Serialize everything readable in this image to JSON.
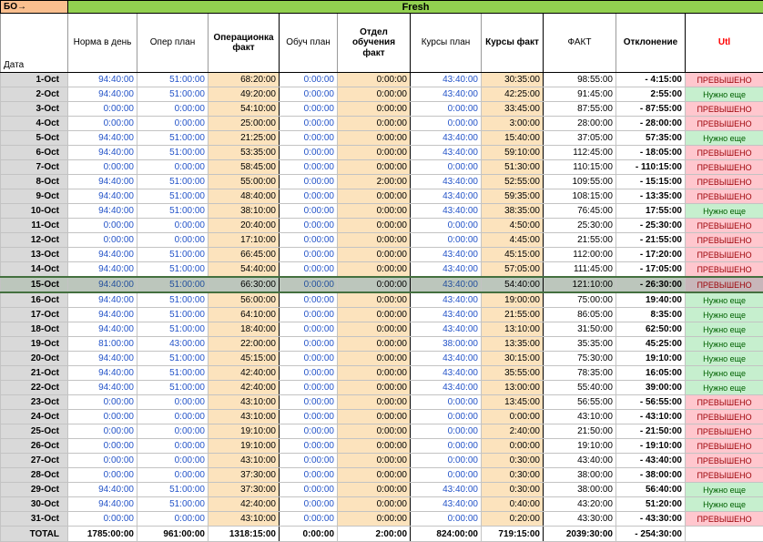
{
  "sheet": {
    "corner_label": "БО→",
    "banner": "Fresh"
  },
  "columns": [
    "Дата",
    "Норма в день",
    "Опер план",
    "Операционка факт",
    "Обуч план",
    "Отдел обучения факт",
    "Курсы план",
    "Курсы факт",
    "ФАКТ",
    "Отклонение",
    "Utl"
  ],
  "colors": {
    "banner_green": "#92D050",
    "corner_orange": "#FABF8F",
    "fact_cell_bg": "#FCE3BD",
    "plan_text_blue": "#2353C8",
    "date_col_grey": "#D9D9D9",
    "utl_over_bg": "#FFC7CE",
    "utl_over_text": "#9C0006",
    "utl_need_bg": "#C6EFCE",
    "utl_need_text": "#006100",
    "utl_header_text": "#FF0000",
    "highlight_row_bg": "#BCC6BC"
  },
  "rows": [
    {
      "date": "1-Oct",
      "norm": "94:40:00",
      "oper_plan": "51:00:00",
      "oper_fact": "68:20:00",
      "edu_plan": "0:00:00",
      "edu_fact": "0:00:00",
      "course_plan": "43:40:00",
      "course_fact": "30:35:00",
      "fact": "98:55:00",
      "deviation": "- 4:15:00",
      "utl": "ПРЕВЫШЕНО",
      "utl_type": "over"
    },
    {
      "date": "2-Oct",
      "norm": "94:40:00",
      "oper_plan": "51:00:00",
      "oper_fact": "49:20:00",
      "edu_plan": "0:00:00",
      "edu_fact": "0:00:00",
      "course_plan": "43:40:00",
      "course_fact": "42:25:00",
      "fact": "91:45:00",
      "deviation": "2:55:00",
      "utl": "Нужно еще",
      "utl_type": "need"
    },
    {
      "date": "3-Oct",
      "norm": "0:00:00",
      "oper_plan": "0:00:00",
      "oper_fact": "54:10:00",
      "edu_plan": "0:00:00",
      "edu_fact": "0:00:00",
      "course_plan": "0:00:00",
      "course_fact": "33:45:00",
      "fact": "87:55:00",
      "deviation": "- 87:55:00",
      "utl": "ПРЕВЫШЕНО",
      "utl_type": "over"
    },
    {
      "date": "4-Oct",
      "norm": "0:00:00",
      "oper_plan": "0:00:00",
      "oper_fact": "25:00:00",
      "edu_plan": "0:00:00",
      "edu_fact": "0:00:00",
      "course_plan": "0:00:00",
      "course_fact": "3:00:00",
      "fact": "28:00:00",
      "deviation": "- 28:00:00",
      "utl": "ПРЕВЫШЕНО",
      "utl_type": "over"
    },
    {
      "date": "5-Oct",
      "norm": "94:40:00",
      "oper_plan": "51:00:00",
      "oper_fact": "21:25:00",
      "edu_plan": "0:00:00",
      "edu_fact": "0:00:00",
      "course_plan": "43:40:00",
      "course_fact": "15:40:00",
      "fact": "37:05:00",
      "deviation": "57:35:00",
      "utl": "Нужно еще",
      "utl_type": "need"
    },
    {
      "date": "6-Oct",
      "norm": "94:40:00",
      "oper_plan": "51:00:00",
      "oper_fact": "53:35:00",
      "edu_plan": "0:00:00",
      "edu_fact": "0:00:00",
      "course_plan": "43:40:00",
      "course_fact": "59:10:00",
      "fact": "112:45:00",
      "deviation": "- 18:05:00",
      "utl": "ПРЕВЫШЕНО",
      "utl_type": "over"
    },
    {
      "date": "7-Oct",
      "norm": "0:00:00",
      "oper_plan": "0:00:00",
      "oper_fact": "58:45:00",
      "edu_plan": "0:00:00",
      "edu_fact": "0:00:00",
      "course_plan": "0:00:00",
      "course_fact": "51:30:00",
      "fact": "110:15:00",
      "deviation": "- 110:15:00",
      "utl": "ПРЕВЫШЕНО",
      "utl_type": "over"
    },
    {
      "date": "8-Oct",
      "norm": "94:40:00",
      "oper_plan": "51:00:00",
      "oper_fact": "55:00:00",
      "edu_plan": "0:00:00",
      "edu_fact": "2:00:00",
      "course_plan": "43:40:00",
      "course_fact": "52:55:00",
      "fact": "109:55:00",
      "deviation": "- 15:15:00",
      "utl": "ПРЕВЫШЕНО",
      "utl_type": "over"
    },
    {
      "date": "9-Oct",
      "norm": "94:40:00",
      "oper_plan": "51:00:00",
      "oper_fact": "48:40:00",
      "edu_plan": "0:00:00",
      "edu_fact": "0:00:00",
      "course_plan": "43:40:00",
      "course_fact": "59:35:00",
      "fact": "108:15:00",
      "deviation": "- 13:35:00",
      "utl": "ПРЕВЫШЕНО",
      "utl_type": "over"
    },
    {
      "date": "10-Oct",
      "norm": "94:40:00",
      "oper_plan": "51:00:00",
      "oper_fact": "38:10:00",
      "edu_plan": "0:00:00",
      "edu_fact": "0:00:00",
      "course_plan": "43:40:00",
      "course_fact": "38:35:00",
      "fact": "76:45:00",
      "deviation": "17:55:00",
      "utl": "Нужно еще",
      "utl_type": "need"
    },
    {
      "date": "11-Oct",
      "norm": "0:00:00",
      "oper_plan": "0:00:00",
      "oper_fact": "20:40:00",
      "edu_plan": "0:00:00",
      "edu_fact": "0:00:00",
      "course_plan": "0:00:00",
      "course_fact": "4:50:00",
      "fact": "25:30:00",
      "deviation": "- 25:30:00",
      "utl": "ПРЕВЫШЕНО",
      "utl_type": "over"
    },
    {
      "date": "12-Oct",
      "norm": "0:00:00",
      "oper_plan": "0:00:00",
      "oper_fact": "17:10:00",
      "edu_plan": "0:00:00",
      "edu_fact": "0:00:00",
      "course_plan": "0:00:00",
      "course_fact": "4:45:00",
      "fact": "21:55:00",
      "deviation": "- 21:55:00",
      "utl": "ПРЕВЫШЕНО",
      "utl_type": "over"
    },
    {
      "date": "13-Oct",
      "norm": "94:40:00",
      "oper_plan": "51:00:00",
      "oper_fact": "66:45:00",
      "edu_plan": "0:00:00",
      "edu_fact": "0:00:00",
      "course_plan": "43:40:00",
      "course_fact": "45:15:00",
      "fact": "112:00:00",
      "deviation": "- 17:20:00",
      "utl": "ПРЕВЫШЕНО",
      "utl_type": "over"
    },
    {
      "date": "14-Oct",
      "norm": "94:40:00",
      "oper_plan": "51:00:00",
      "oper_fact": "54:40:00",
      "edu_plan": "0:00:00",
      "edu_fact": "0:00:00",
      "course_plan": "43:40:00",
      "course_fact": "57:05:00",
      "fact": "111:45:00",
      "deviation": "- 17:05:00",
      "utl": "ПРЕВЫШЕНО",
      "utl_type": "over"
    },
    {
      "date": "15-Oct",
      "norm": "94:40:00",
      "oper_plan": "51:00:00",
      "oper_fact": "66:30:00",
      "edu_plan": "0:00:00",
      "edu_fact": "0:00:00",
      "course_plan": "43:40:00",
      "course_fact": "54:40:00",
      "fact": "121:10:00",
      "deviation": "- 26:30:00",
      "utl": "ПРЕВЫШЕНО",
      "utl_type": "over",
      "highlighted": true
    },
    {
      "date": "16-Oct",
      "norm": "94:40:00",
      "oper_plan": "51:00:00",
      "oper_fact": "56:00:00",
      "edu_plan": "0:00:00",
      "edu_fact": "0:00:00",
      "course_plan": "43:40:00",
      "course_fact": "19:00:00",
      "fact": "75:00:00",
      "deviation": "19:40:00",
      "utl": "Нужно еще",
      "utl_type": "need"
    },
    {
      "date": "17-Oct",
      "norm": "94:40:00",
      "oper_plan": "51:00:00",
      "oper_fact": "64:10:00",
      "edu_plan": "0:00:00",
      "edu_fact": "0:00:00",
      "course_plan": "43:40:00",
      "course_fact": "21:55:00",
      "fact": "86:05:00",
      "deviation": "8:35:00",
      "utl": "Нужно еще",
      "utl_type": "need"
    },
    {
      "date": "18-Oct",
      "norm": "94:40:00",
      "oper_plan": "51:00:00",
      "oper_fact": "18:40:00",
      "edu_plan": "0:00:00",
      "edu_fact": "0:00:00",
      "course_plan": "43:40:00",
      "course_fact": "13:10:00",
      "fact": "31:50:00",
      "deviation": "62:50:00",
      "utl": "Нужно еще",
      "utl_type": "need"
    },
    {
      "date": "19-Oct",
      "norm": "81:00:00",
      "oper_plan": "43:00:00",
      "oper_fact": "22:00:00",
      "edu_plan": "0:00:00",
      "edu_fact": "0:00:00",
      "course_plan": "38:00:00",
      "course_fact": "13:35:00",
      "fact": "35:35:00",
      "deviation": "45:25:00",
      "utl": "Нужно еще",
      "utl_type": "need"
    },
    {
      "date": "20-Oct",
      "norm": "94:40:00",
      "oper_plan": "51:00:00",
      "oper_fact": "45:15:00",
      "edu_plan": "0:00:00",
      "edu_fact": "0:00:00",
      "course_plan": "43:40:00",
      "course_fact": "30:15:00",
      "fact": "75:30:00",
      "deviation": "19:10:00",
      "utl": "Нужно еще",
      "utl_type": "need"
    },
    {
      "date": "21-Oct",
      "norm": "94:40:00",
      "oper_plan": "51:00:00",
      "oper_fact": "42:40:00",
      "edu_plan": "0:00:00",
      "edu_fact": "0:00:00",
      "course_plan": "43:40:00",
      "course_fact": "35:55:00",
      "fact": "78:35:00",
      "deviation": "16:05:00",
      "utl": "Нужно еще",
      "utl_type": "need"
    },
    {
      "date": "22-Oct",
      "norm": "94:40:00",
      "oper_plan": "51:00:00",
      "oper_fact": "42:40:00",
      "edu_plan": "0:00:00",
      "edu_fact": "0:00:00",
      "course_plan": "43:40:00",
      "course_fact": "13:00:00",
      "fact": "55:40:00",
      "deviation": "39:00:00",
      "utl": "Нужно еще",
      "utl_type": "need"
    },
    {
      "date": "23-Oct",
      "norm": "0:00:00",
      "oper_plan": "0:00:00",
      "oper_fact": "43:10:00",
      "edu_plan": "0:00:00",
      "edu_fact": "0:00:00",
      "course_plan": "0:00:00",
      "course_fact": "13:45:00",
      "fact": "56:55:00",
      "deviation": "- 56:55:00",
      "utl": "ПРЕВЫШЕНО",
      "utl_type": "over"
    },
    {
      "date": "24-Oct",
      "norm": "0:00:00",
      "oper_plan": "0:00:00",
      "oper_fact": "43:10:00",
      "edu_plan": "0:00:00",
      "edu_fact": "0:00:00",
      "course_plan": "0:00:00",
      "course_fact": "0:00:00",
      "fact": "43:10:00",
      "deviation": "- 43:10:00",
      "utl": "ПРЕВЫШЕНО",
      "utl_type": "over"
    },
    {
      "date": "25-Oct",
      "norm": "0:00:00",
      "oper_plan": "0:00:00",
      "oper_fact": "19:10:00",
      "edu_plan": "0:00:00",
      "edu_fact": "0:00:00",
      "course_plan": "0:00:00",
      "course_fact": "2:40:00",
      "fact": "21:50:00",
      "deviation": "- 21:50:00",
      "utl": "ПРЕВЫШЕНО",
      "utl_type": "over"
    },
    {
      "date": "26-Oct",
      "norm": "0:00:00",
      "oper_plan": "0:00:00",
      "oper_fact": "19:10:00",
      "edu_plan": "0:00:00",
      "edu_fact": "0:00:00",
      "course_plan": "0:00:00",
      "course_fact": "0:00:00",
      "fact": "19:10:00",
      "deviation": "- 19:10:00",
      "utl": "ПРЕВЫШЕНО",
      "utl_type": "over"
    },
    {
      "date": "27-Oct",
      "norm": "0:00:00",
      "oper_plan": "0:00:00",
      "oper_fact": "43:10:00",
      "edu_plan": "0:00:00",
      "edu_fact": "0:00:00",
      "course_plan": "0:00:00",
      "course_fact": "0:30:00",
      "fact": "43:40:00",
      "deviation": "- 43:40:00",
      "utl": "ПРЕВЫШЕНО",
      "utl_type": "over"
    },
    {
      "date": "28-Oct",
      "norm": "0:00:00",
      "oper_plan": "0:00:00",
      "oper_fact": "37:30:00",
      "edu_plan": "0:00:00",
      "edu_fact": "0:00:00",
      "course_plan": "0:00:00",
      "course_fact": "0:30:00",
      "fact": "38:00:00",
      "deviation": "- 38:00:00",
      "utl": "ПРЕВЫШЕНО",
      "utl_type": "over"
    },
    {
      "date": "29-Oct",
      "norm": "94:40:00",
      "oper_plan": "51:00:00",
      "oper_fact": "37:30:00",
      "edu_plan": "0:00:00",
      "edu_fact": "0:00:00",
      "course_plan": "43:40:00",
      "course_fact": "0:30:00",
      "fact": "38:00:00",
      "deviation": "56:40:00",
      "utl": "Нужно еще",
      "utl_type": "need"
    },
    {
      "date": "30-Oct",
      "norm": "94:40:00",
      "oper_plan": "51:00:00",
      "oper_fact": "42:40:00",
      "edu_plan": "0:00:00",
      "edu_fact": "0:00:00",
      "course_plan": "43:40:00",
      "course_fact": "0:40:00",
      "fact": "43:20:00",
      "deviation": "51:20:00",
      "utl": "Нужно еще",
      "utl_type": "need"
    },
    {
      "date": "31-Oct",
      "norm": "0:00:00",
      "oper_plan": "0:00:00",
      "oper_fact": "43:10:00",
      "edu_plan": "0:00:00",
      "edu_fact": "0:00:00",
      "course_plan": "0:00:00",
      "course_fact": "0:20:00",
      "fact": "43:30:00",
      "deviation": "- 43:30:00",
      "utl": "ПРЕВЫШЕНО",
      "utl_type": "over"
    }
  ],
  "total": {
    "label": "TOTAL",
    "norm": "1785:00:00",
    "oper_plan": "961:00:00",
    "oper_fact": "1318:15:00",
    "edu_plan": "0:00:00",
    "edu_fact": "2:00:00",
    "course_plan": "824:00:00",
    "course_fact": "719:15:00",
    "fact": "2039:30:00",
    "deviation": "- 254:30:00",
    "utl": ""
  }
}
